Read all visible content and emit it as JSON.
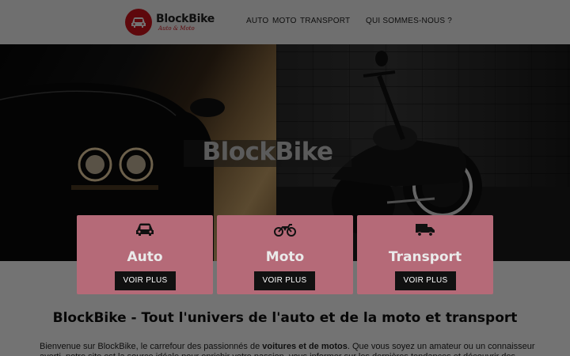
{
  "brand": {
    "name": "BlockBike",
    "tagline": "Auto & Moto"
  },
  "nav": {
    "items": [
      {
        "label": "AUTO"
      },
      {
        "label": "MOTO"
      },
      {
        "label": "TRANSPORT"
      },
      {
        "label": "QUI SOMMES-NOUS ?"
      }
    ]
  },
  "hero": {
    "title": "BlockBike"
  },
  "cards": [
    {
      "title": "Auto",
      "button": "VOIR PLUS",
      "icon": "car-icon"
    },
    {
      "title": "Moto",
      "button": "VOIR PLUS",
      "icon": "motorcycle-icon"
    },
    {
      "title": "Transport",
      "button": "VOIR PLUS",
      "icon": "truck-icon"
    }
  ],
  "content": {
    "heading": "BlockBike - Tout l'univers de l'auto et de la moto et transport",
    "intro_prefix": "Bienvenue sur BlockBike, le carrefour des passionnés de ",
    "intro_bold": "voitures et de motos",
    "intro_suffix": ". Que vous soyez un amateur ou un connaisseur averti, notre site est la source idéale pour enrichir votre passion, vous informer sur les dernières tendances et découvrir des"
  },
  "colors": {
    "brand_red": "#d0121b",
    "card_bg": "#b56a78",
    "button_bg": "#111111"
  }
}
